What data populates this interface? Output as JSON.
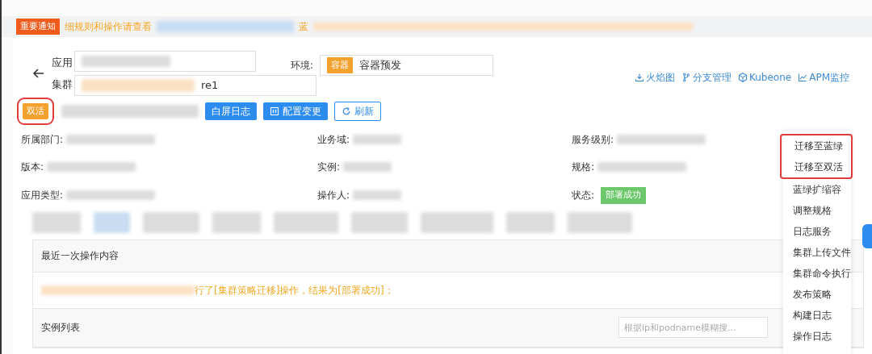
{
  "notice": {
    "badge": "重要通知",
    "text": "细规则和操作请查看",
    "tail": "蓝"
  },
  "filters": {
    "app_label": "应用",
    "cluster_label": "集群",
    "cluster_value": "re1",
    "env_label": "环境:",
    "env_tag": "容器",
    "env_value": "容器预发"
  },
  "links": [
    {
      "kind": "download",
      "label": "火焰图"
    },
    {
      "kind": "branch",
      "label": "分支管理"
    },
    {
      "kind": "cube",
      "label": "Kubeone"
    },
    {
      "kind": "chart",
      "label": "APM监控"
    }
  ],
  "mode_tag": {
    "label": "双活",
    "highlighted": true
  },
  "actions": [
    {
      "kind": "plain",
      "label": "白屏日志"
    },
    {
      "kind": "config",
      "label": "配置变更"
    },
    {
      "kind": "refresh",
      "label": "刷新"
    }
  ],
  "info": [
    {
      "label": "所属部门:"
    },
    {
      "label": "业务域:"
    },
    {
      "label": "服务级别:"
    },
    {
      "label": "版本:"
    },
    {
      "label": "实例:"
    },
    {
      "label": "规格:"
    },
    {
      "label": "应用类型:"
    },
    {
      "label": "操作人:"
    },
    {
      "label": "状态:",
      "status": "部署成功"
    }
  ],
  "last_operation": {
    "title": "最近一次操作内容",
    "message": "行了[集群策略迁移]操作，结果为[部署成功]；"
  },
  "instances": {
    "title": "实例列表",
    "search": {
      "placeholder": "根据ip和podname模糊搜..."
    }
  },
  "menu": [
    {
      "label": "迁移至蓝绿",
      "highlighted": true
    },
    {
      "label": "迁移至双活",
      "highlighted": true
    },
    {
      "label": "蓝绿扩缩容",
      "highlighted": false
    },
    {
      "label": "调整规格",
      "highlighted": false
    },
    {
      "label": "日志服务",
      "highlighted": false
    },
    {
      "label": "集群上传文件",
      "highlighted": false
    },
    {
      "label": "集群命令执行",
      "highlighted": false
    },
    {
      "label": "发布策略",
      "highlighted": false
    },
    {
      "label": "构建日志",
      "highlighted": false
    },
    {
      "label": "操作日志",
      "highlighted": false
    }
  ]
}
